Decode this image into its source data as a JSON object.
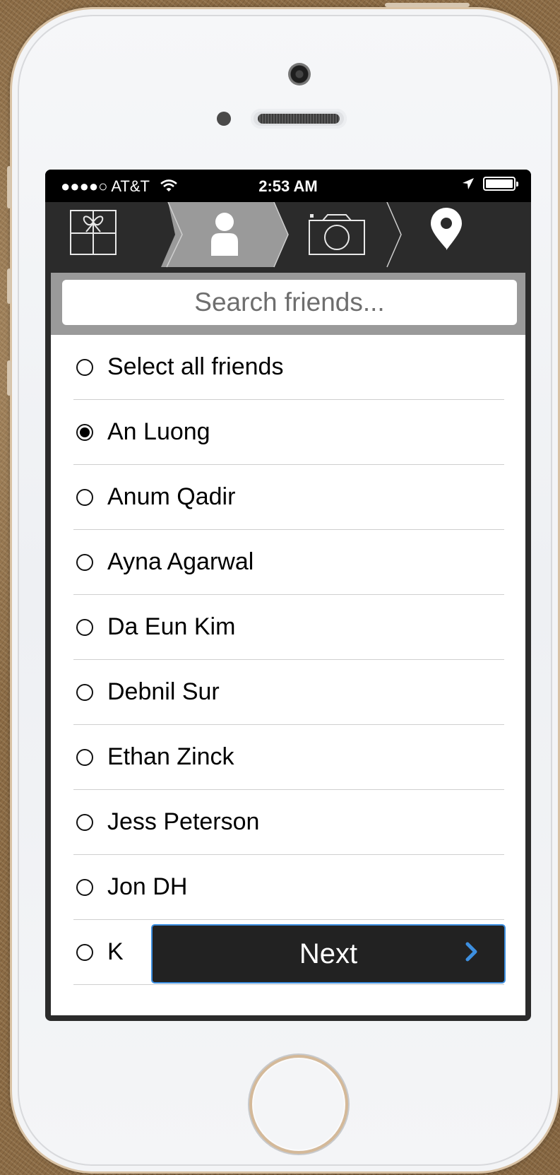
{
  "status_bar": {
    "carrier": "●●●●○ AT&T",
    "time": "2:53 AM"
  },
  "steps": [
    {
      "icon": "gift-icon",
      "active": false
    },
    {
      "icon": "person-icon",
      "active": true
    },
    {
      "icon": "camera-icon",
      "active": false
    },
    {
      "icon": "location-pin-icon",
      "active": false
    }
  ],
  "search": {
    "placeholder": "Search friends..."
  },
  "list": {
    "select_all": "Select all friends",
    "friends": [
      {
        "name": "An Luong",
        "selected": true
      },
      {
        "name": "Anum Qadir",
        "selected": false
      },
      {
        "name": "Ayna Agarwal",
        "selected": false
      },
      {
        "name": "Da Eun Kim",
        "selected": false
      },
      {
        "name": "Debnil Sur",
        "selected": false
      },
      {
        "name": "Ethan Zinck",
        "selected": false
      },
      {
        "name": "Jess Peterson",
        "selected": false
      },
      {
        "name": "Jon DH",
        "selected": false
      },
      {
        "name": "K",
        "selected": false
      }
    ]
  },
  "next_button": {
    "label": "Next"
  },
  "colors": {
    "nav_bar": "#2b2b2b",
    "active_step": "#9a9a9a",
    "next_border": "#3d8fe0",
    "chevron": "#3d8fe0"
  }
}
